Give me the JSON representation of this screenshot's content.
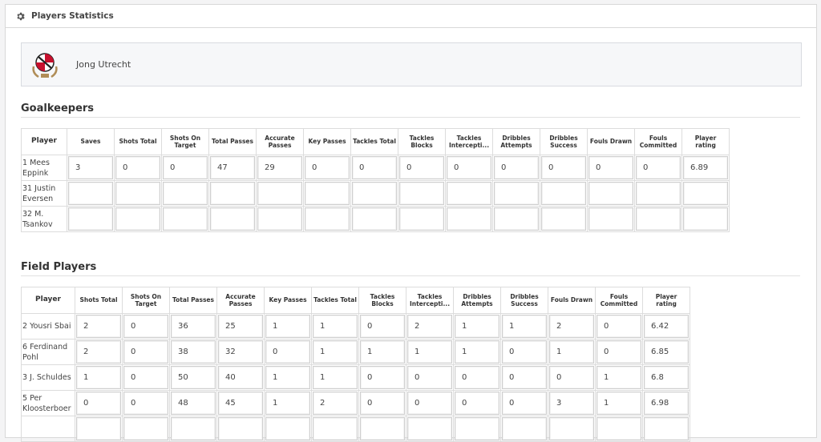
{
  "header": {
    "title": "Players Statistics",
    "icon": "gear-icon"
  },
  "team": {
    "name": "Jong Utrecht",
    "logo_icon": "utrecht-crest-icon",
    "colors": {
      "red": "#c8102e",
      "gold": "#b08d57"
    }
  },
  "goalkeepers": {
    "title": "Goalkeepers",
    "columns": [
      "Player",
      "Saves",
      "Shots Total",
      "Shots On Target",
      "Total Passes",
      "Accurate Passes",
      "Key Passes",
      "Tackles Total",
      "Tackles Blocks",
      "Tackles Intercepti...",
      "Dribbles Attempts",
      "Dribbles Success",
      "Fouls Drawn",
      "Fouls Committed",
      "Player rating"
    ],
    "rows": [
      {
        "player": "1  Mees Eppink",
        "values": [
          "3",
          "0",
          "0",
          "47",
          "29",
          "0",
          "0",
          "0",
          "0",
          "0",
          "0",
          "0",
          "0",
          "6.89"
        ]
      },
      {
        "player": "31  Justin Eversen",
        "values": [
          "",
          "",
          "",
          "",
          "",
          "",
          "",
          "",
          "",
          "",
          "",
          "",
          "",
          ""
        ]
      },
      {
        "player": "32  M. Tsankov",
        "values": [
          "",
          "",
          "",
          "",
          "",
          "",
          "",
          "",
          "",
          "",
          "",
          "",
          "",
          ""
        ]
      }
    ]
  },
  "field_players": {
    "title": "Field Players",
    "columns": [
      "Player",
      "Shots Total",
      "Shots On Target",
      "Total Passes",
      "Accurate Passes",
      "Key Passes",
      "Tackles Total",
      "Tackles Blocks",
      "Tackles Intercepti...",
      "Dribbles Attempts",
      "Dribbles Success",
      "Fouls Drawn",
      "Fouls Committed",
      "Player rating"
    ],
    "rows": [
      {
        "player": "2  Yousri Sbai",
        "values": [
          "2",
          "0",
          "36",
          "25",
          "1",
          "1",
          "0",
          "2",
          "1",
          "1",
          "2",
          "0",
          "6.42"
        ]
      },
      {
        "player": "6  Ferdinand Pohl",
        "values": [
          "2",
          "0",
          "38",
          "32",
          "0",
          "1",
          "1",
          "1",
          "1",
          "0",
          "1",
          "0",
          "6.85"
        ]
      },
      {
        "player": "3  J. Schuldes",
        "values": [
          "1",
          "0",
          "50",
          "40",
          "1",
          "1",
          "0",
          "0",
          "0",
          "0",
          "0",
          "1",
          "6.8"
        ]
      },
      {
        "player": "5  Per Kloosterboer",
        "values": [
          "0",
          "0",
          "48",
          "45",
          "1",
          "2",
          "0",
          "0",
          "0",
          "0",
          "3",
          "1",
          "6.98"
        ]
      },
      {
        "player": "",
        "values": [
          "",
          "",
          "",
          "",
          "",
          "",
          "",
          "",
          "",
          "",
          "",
          "",
          ""
        ]
      }
    ]
  }
}
